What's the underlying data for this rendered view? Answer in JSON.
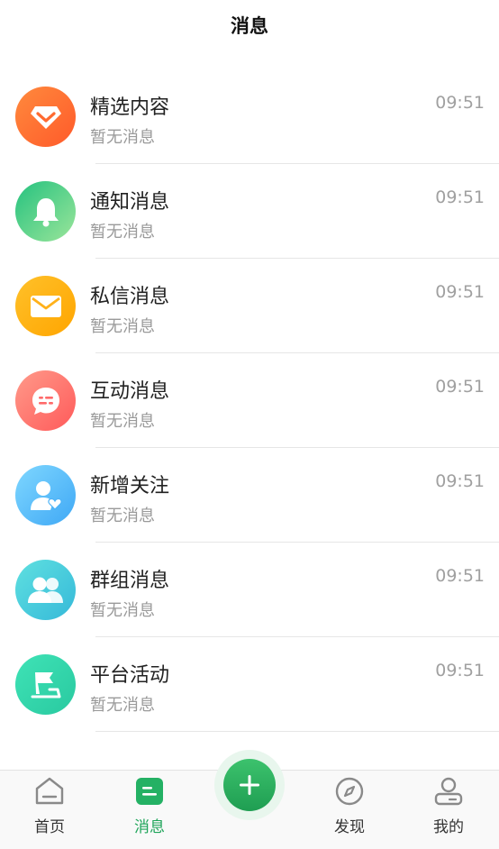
{
  "header": {
    "title": "消息"
  },
  "messages": [
    {
      "title": "精选内容",
      "subtitle": "暂无消息",
      "time": "09:51",
      "icon": "diamond-icon"
    },
    {
      "title": "通知消息",
      "subtitle": "暂无消息",
      "time": "09:51",
      "icon": "bell-icon"
    },
    {
      "title": "私信消息",
      "subtitle": "暂无消息",
      "time": "09:51",
      "icon": "envelope-icon"
    },
    {
      "title": "互动消息",
      "subtitle": "暂无消息",
      "time": "09:51",
      "icon": "chat-bubble-icon"
    },
    {
      "title": "新增关注",
      "subtitle": "暂无消息",
      "time": "09:51",
      "icon": "user-heart-icon"
    },
    {
      "title": "群组消息",
      "subtitle": "暂无消息",
      "time": "09:51",
      "icon": "group-icon"
    },
    {
      "title": "平台活动",
      "subtitle": "暂无消息",
      "time": "09:51",
      "icon": "flag-icon"
    }
  ],
  "tabs": [
    {
      "label": "首页",
      "icon": "home-icon",
      "active": false
    },
    {
      "label": "消息",
      "icon": "message-icon",
      "active": true
    },
    {
      "label": "",
      "icon": "plus-icon",
      "active": false
    },
    {
      "label": "发现",
      "icon": "compass-icon",
      "active": false
    },
    {
      "label": "我的",
      "icon": "profile-icon",
      "active": false
    }
  ],
  "colors": {
    "accent": "#1fa55a",
    "text_primary": "#222222",
    "text_secondary": "#9a9a9a",
    "time": "#a0a0a0"
  }
}
